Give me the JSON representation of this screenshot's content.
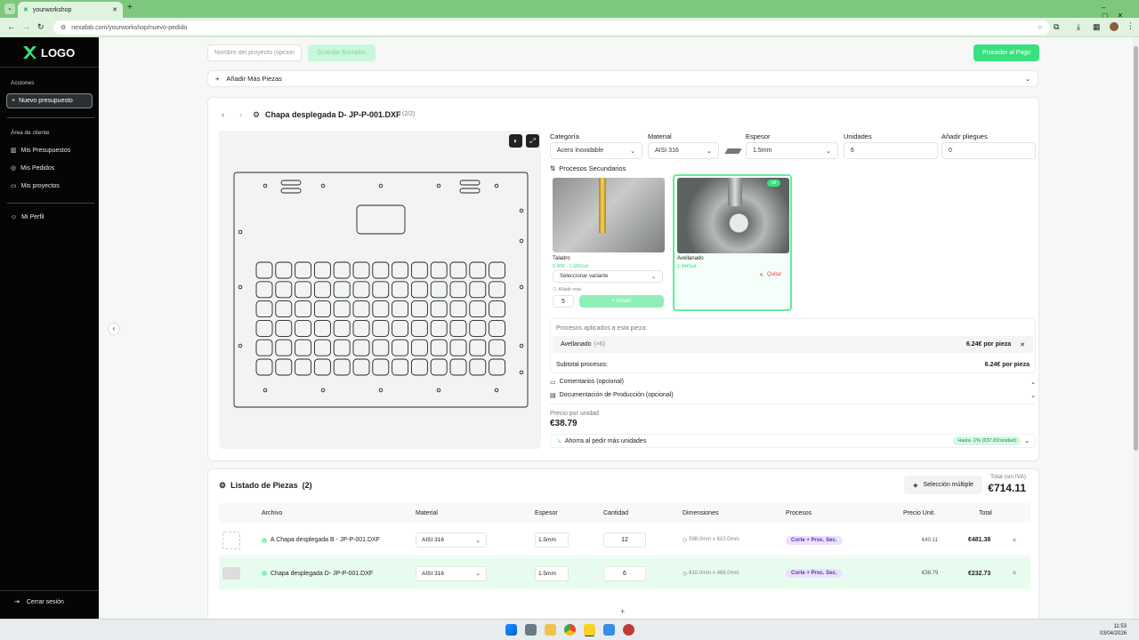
{
  "browser": {
    "tab_title": "yourworkshop",
    "url": "nexafab.com/yourworkshop/nuevo-pedido"
  },
  "sidebar": {
    "logo": "LOGO",
    "acciones_title": "Acciones",
    "new_quote": "Nuevo presupuesto",
    "client_area_title": "Área de cliente",
    "items": [
      "Mis Presupuestos",
      "Mis Pedidos",
      "Mis proyectos"
    ],
    "profile": "Mi Perfil",
    "logout": "Cerrar sesión"
  },
  "toolbar": {
    "project_placeholder": "Nombre del proyecto (opcional)",
    "save_draft": "Guardar Borrador",
    "checkout": "Proceder al Pago"
  },
  "add_more": "Añadir Más Piezas",
  "piece": {
    "title": "Chapa desplegada D- JP-P-001.DXF",
    "counter": "(2/2)",
    "category_label": "Categoría",
    "category_value": "Acero Inoxidable",
    "material_label": "Material",
    "material_value": "AISI 316",
    "thickness_label": "Espesor",
    "thickness_value": "1.5mm",
    "units_label": "Unidades",
    "units_value": "6",
    "bends_label": "Añadir pliegues",
    "bends_value": "0",
    "secondary_title": "Procesos Secundarios",
    "proc1_name": "Taladro",
    "proc1_price": "0.80€ - 1.68€/ud",
    "proc1_select": "Seleccionar variante",
    "proc1_note": "Añadir nota",
    "proc1_qty": "5",
    "proc1_add": "+ Añadir",
    "proc2_name": "Avellanado",
    "proc2_price": "1.04€/ud",
    "proc2_badge": "x6",
    "proc2_remove": "Quitar",
    "applied_title": "Procesos aplicados a esta pieza:",
    "applied_item": "Avellanado",
    "applied_item_qty": "(×6)",
    "applied_item_price": "6.24€ por pieza",
    "subtotal_label": "Subtotal procesos:",
    "subtotal_value": "6.24€ por pieza",
    "comments": "Comentarios (opcional)",
    "docs": "Documentación de Producción (opcional)",
    "unit_price_label": "Precio por unidad",
    "unit_price": "€38.79",
    "savings": "Ahorra al pedir más unidades",
    "savings_badge": "Hasta -1% (€37.83/unidad)"
  },
  "list": {
    "title": "Listado de Piezas",
    "count": "(2)",
    "multi_select": "Selección múltiple",
    "total_label": "Total (sin IVA)",
    "total": "€714.11",
    "headers": [
      "Archivo",
      "Material",
      "Espesor",
      "Cantidad",
      "Dimensiones",
      "Procesos",
      "Precio Unit.",
      "Total"
    ],
    "rows": [
      {
        "file": "A Chapa desplegada B - JP-P-001.DXF",
        "material": "AISI 316",
        "thickness": "1.5mm",
        "qty": "12",
        "dims": "598.0mm x 610.0mm",
        "proc": "Corte + Proc. Sec.",
        "unit": "€40.11",
        "total": "€481.38"
      },
      {
        "file": "Chapa desplegada D- JP-P-001.DXF",
        "material": "AISI 316",
        "thickness": "1.5mm",
        "qty": "6",
        "dims": "610.0mm x 466.0mm",
        "proc": "Corte + Proc. Sec.",
        "unit": "€38.79",
        "total": "€232.73"
      }
    ]
  },
  "taskbar": {
    "time": "11:53",
    "date": "03/04/2026"
  },
  "colors": {
    "accent": "#39e07e",
    "sidebar": "#050505",
    "chrome": "#7ec87e"
  }
}
